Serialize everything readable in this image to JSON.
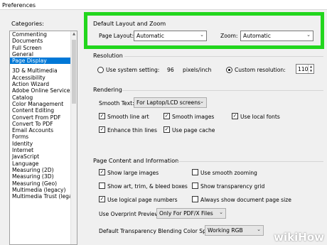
{
  "window": {
    "title": "Preferences"
  },
  "categories": {
    "label": "Categories:",
    "group1": [
      "Commenting",
      "Documents",
      "Full Screen",
      "General",
      "Page Display"
    ],
    "group2": [
      "3D & Multimedia",
      "Accessibility",
      "Action Wizard",
      "Adobe Online Services",
      "Catalog",
      "Color Management",
      "Content Editing",
      "Convert From PDF",
      "Convert To PDF",
      "Email Accounts",
      "Forms",
      "Identity",
      "Internet",
      "JavaScript",
      "Language",
      "Measuring (2D)",
      "Measuring (3D)",
      "Measuring (Geo)",
      "Multimedia (legacy)",
      "Multimedia Trust (legacy)"
    ],
    "selected": "Page Display"
  },
  "default_layout": {
    "title": "Default Layout and Zoom",
    "page_layout_label": "Page Layout:",
    "page_layout_value": "Automatic",
    "zoom_label": "Zoom:",
    "zoom_value": "Automatic"
  },
  "resolution": {
    "title": "Resolution",
    "system_label": "Use system setting:",
    "system_value": "96",
    "system_unit": "pixels/inch",
    "custom_label": "Custom resolution:",
    "custom_value": "110",
    "custom_selected": true
  },
  "rendering": {
    "title": "Rendering",
    "smooth_text_label": "Smooth Text:",
    "smooth_text_value": "For Laptop/LCD screens",
    "smooth_line_art": "Smooth line art",
    "smooth_images": "Smooth images",
    "use_local_fonts": "Use local fonts",
    "enhance_thin_lines": "Enhance thin lines",
    "use_page_cache": "Use page cache"
  },
  "page_content": {
    "title": "Page Content and Information",
    "show_large_images": "Show large images",
    "use_smooth_zooming": "Use smooth zooming",
    "show_art_trim": "Show art, trim, & bleed boxes",
    "show_transparency_grid": "Show transparency grid",
    "use_logical_page_numbers": "Use logical page numbers",
    "always_show_page_size": "Always show document page size",
    "overprint_label": "Use Overprint Preview:",
    "overprint_value": "Only For PDF/X Files",
    "blending_label": "Default Transparency Blending Color Space:",
    "blending_value": "Working RGB"
  },
  "watermark": "wikiHow",
  "colors": {
    "highlight": "#22d61d",
    "selection": "#0078d7"
  }
}
